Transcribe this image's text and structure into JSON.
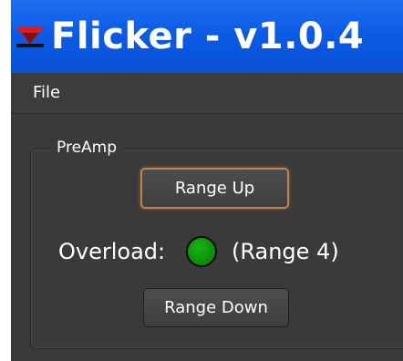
{
  "window": {
    "title": "Flicker - v1.0.4",
    "icon": "flicker-app-icon"
  },
  "menubar": {
    "items": [
      {
        "label": "File"
      }
    ]
  },
  "preamp": {
    "group_title": "PreAmp",
    "range_up_label": "Range Up",
    "range_down_label": "Range Down",
    "overload_label": "Overload:",
    "range_text": "(Range 4)",
    "overload_indicator": {
      "state": "ok",
      "color": "#0a9a0a"
    }
  },
  "colors": {
    "titlebar": "#0b5be6",
    "background": "#3a3a3a",
    "focus_outline": "#b9864a",
    "icon_red": "#e11b1b"
  }
}
